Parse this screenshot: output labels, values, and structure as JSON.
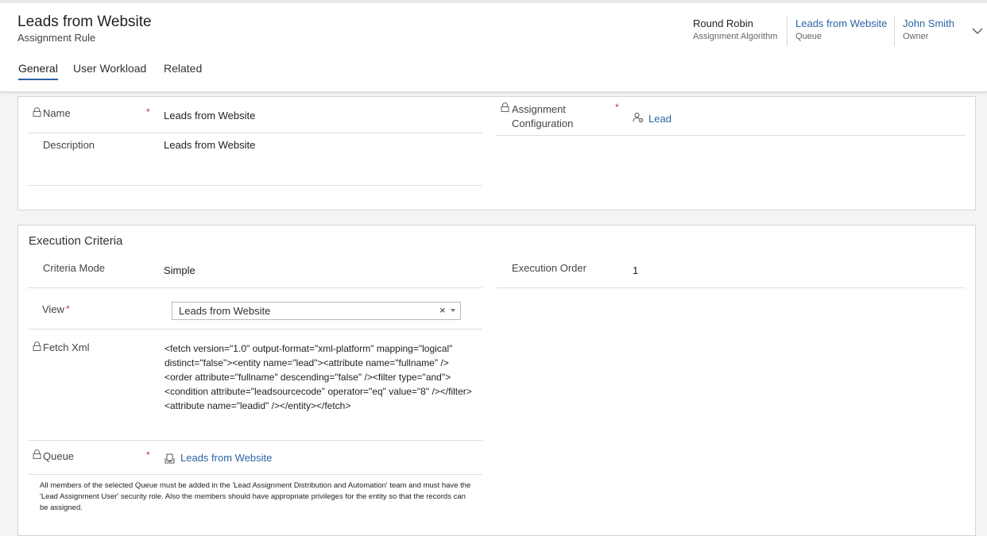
{
  "header": {
    "title": "Leads from Website",
    "subtitle": "Assignment Rule",
    "fields": [
      {
        "value": "Round Robin",
        "label": "Assignment Algorithm"
      },
      {
        "value": "Leads from Website",
        "label": "Queue"
      },
      {
        "value": "John Smith",
        "label": "Owner"
      }
    ],
    "expand_icon": "chevron-down-icon"
  },
  "tabs": [
    {
      "label": "General",
      "active": true
    },
    {
      "label": "User Workload",
      "active": false
    },
    {
      "label": "Related",
      "active": false
    }
  ],
  "general": {
    "name": {
      "label": "Name",
      "value": "Leads from Website",
      "required": "*",
      "icon": "lock-icon"
    },
    "description": {
      "label": "Description",
      "value": "Leads from Website"
    },
    "assignment_configuration": {
      "label_line1": "Assignment",
      "label_line2": "Configuration",
      "value": "Lead",
      "required": "*",
      "icon": "lock-icon",
      "value_icon": "entity-icon"
    }
  },
  "execution_criteria": {
    "title": "Execution Criteria",
    "criteria_mode": {
      "label": "Criteria Mode",
      "value": "Simple"
    },
    "execution_order": {
      "label": "Execution Order",
      "value": "1"
    },
    "view": {
      "label": "View",
      "required": "*",
      "value": "Leads from Website",
      "clear": "×"
    },
    "fetch_xml": {
      "label": "Fetch Xml",
      "icon": "lock-icon",
      "value": "<fetch version=\"1.0\" output-format=\"xml-platform\" mapping=\"logical\" distinct=\"false\"><entity name=\"lead\"><attribute name=\"fullname\" /><order attribute=\"fullname\" descending=\"false\" /><filter type=\"and\"><condition attribute=\"leadsourcecode\" operator=\"eq\" value=\"8\" /></filter><attribute name=\"leadid\" /></entity></fetch>"
    },
    "queue": {
      "label": "Queue",
      "required": "*",
      "icon": "lock-icon",
      "value": "Leads from Website",
      "value_icon": "queue-icon"
    },
    "note": "All members of the selected Queue must be added in the 'Lead Assignment Distribution and Automation' team and must have the 'Lead Assignment User' security role. Also the members should have appropriate privileges for the entity so that the records can be assigned."
  },
  "colors": {
    "link": "#2b64a5",
    "required": "#c0392b",
    "tab_underline": "#2b64a5"
  }
}
